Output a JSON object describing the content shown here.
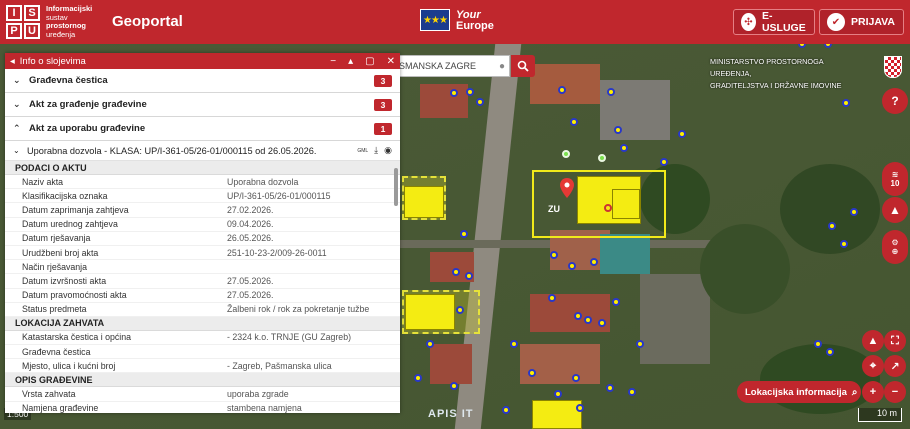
{
  "header": {
    "logo_letters": [
      "I",
      "S",
      "P",
      "U"
    ],
    "org_lines": [
      "Informacijski",
      "sustav",
      "prostornog",
      "uređenja"
    ],
    "app_title": "Geoportal",
    "eu_stars": "★★★",
    "your_europe_line1": "Your",
    "your_europe_line2": "Europe",
    "eusluge_label": "E-USLUGE",
    "prijava_label": "PRIJAVA"
  },
  "search": {
    "value": "SMANSKA ZAGRE"
  },
  "ministry_text_line1": "MINISTARSTVO PROSTORNOGA UREĐENJA,",
  "ministry_text_line2": "GRADITELJSTVA I DRŽAVNE IMOVINE",
  "right_controls": {
    "help": "?",
    "layers_count": "10"
  },
  "map_labels": {
    "parcel_code": "ZU"
  },
  "location_info_label": "Lokacijska informacija",
  "scale_label": "10 m",
  "scale_left": "1:500",
  "brand_footer": "APIS IT",
  "panel": {
    "title": "Info o slojevima",
    "sections": [
      {
        "label": "Građevna čestica",
        "count": "3",
        "expanded": false
      },
      {
        "label": "Akt za građenje građevine",
        "count": "3",
        "expanded": false
      },
      {
        "label": "Akt za uporabu građevine",
        "count": "1",
        "expanded": true
      }
    ],
    "subitem": {
      "label": "Uporabna dozvola - KLASA: UP/I-361-05/26-01/000115 od 26.05.2026.",
      "gml_label": "GML"
    },
    "groups": [
      {
        "title": "PODACI O AKTU",
        "rows": [
          {
            "k": "Naziv akta",
            "v": "Uporabna dozvola"
          },
          {
            "k": "Klasifikacijska oznaka",
            "v": "UP/I-361-05/26-01/000115"
          },
          {
            "k": "Datum zaprimanja zahtjeva",
            "v": "27.02.2026."
          },
          {
            "k": "Datum urednog zahtjeva",
            "v": "09.04.2026."
          },
          {
            "k": "Datum rješavanja",
            "v": "26.05.2026."
          },
          {
            "k": "Urudžbeni broj akta",
            "v": "251-10-23-2/009-26-0011"
          },
          {
            "k": "Način rješavanja",
            "v": ""
          },
          {
            "k": "Datum izvršnosti akta",
            "v": "27.05.2026."
          },
          {
            "k": "Datum pravomoćnosti akta",
            "v": "27.05.2026."
          },
          {
            "k": "Status predmeta",
            "v": "Žalbeni rok / rok za pokretanje tužbe"
          }
        ]
      },
      {
        "title": "LOKACIJA ZAHVATA",
        "rows": [
          {
            "k": "Katastarska čestica i općina",
            "v": "- 2324 k.o. TRNJE (GU Zagreb)"
          },
          {
            "k": "Građevna čestica",
            "v": ""
          },
          {
            "k": "Mjesto, ulica i kućni broj",
            "v": "- Zagreb, Pašmanska ulica"
          }
        ]
      },
      {
        "title": "OPIS GRAĐEVINE",
        "rows": [
          {
            "k": "Vrsta zahvata",
            "v": "uporaba zgrade"
          },
          {
            "k": "Namjena građevine",
            "v": "stambena namjena"
          }
        ]
      }
    ]
  },
  "colors": {
    "brand_red": "#c0272d",
    "highlight_yellow": "#f4ec12"
  },
  "icons": {
    "close": "close-icon",
    "minimize": "minimize-icon",
    "maximize": "maximize-icon",
    "collapse": "chevron-up-icon",
    "download": "download-icon",
    "view": "eye-icon",
    "search": "search-icon",
    "layers": "layers-icon",
    "help": "help-icon"
  }
}
